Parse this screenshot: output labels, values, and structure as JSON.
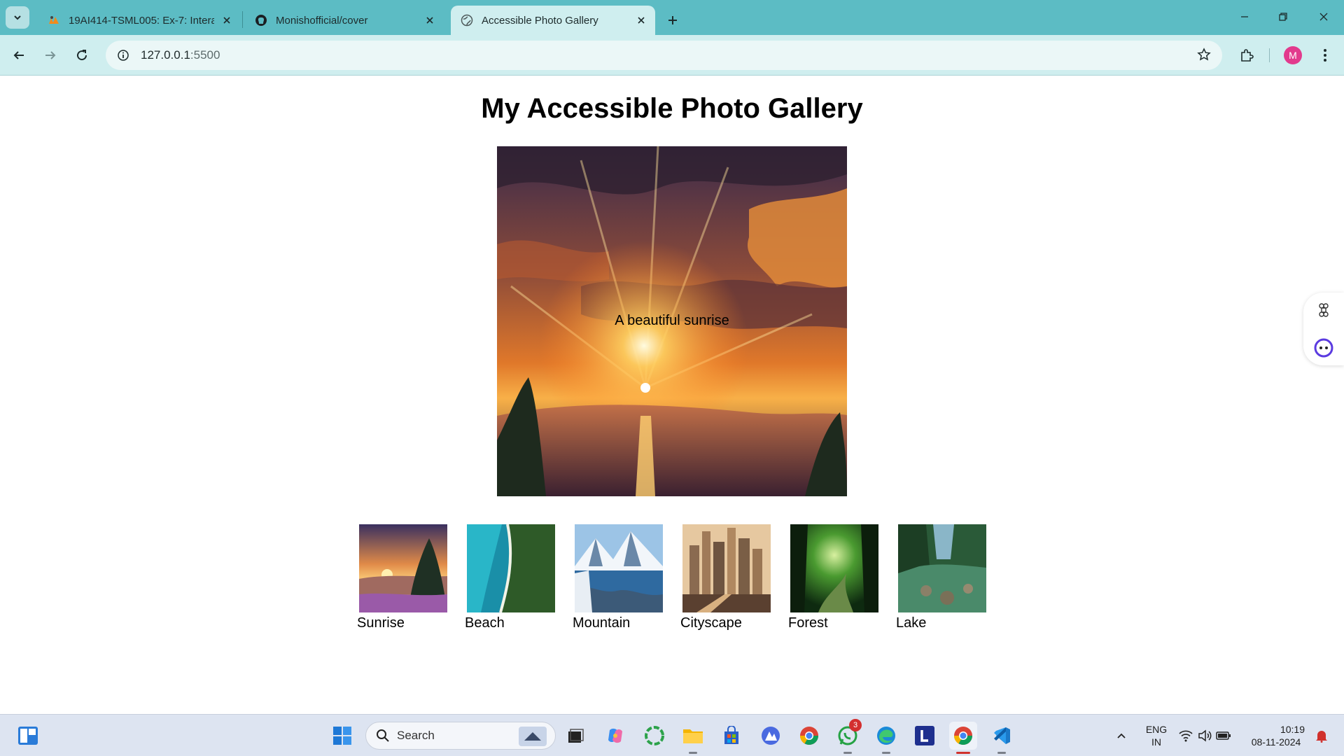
{
  "browser": {
    "tabs": [
      {
        "title": "19AI414-TSML005: Ex-7: Interac",
        "favicon": "moodle-icon",
        "active": false
      },
      {
        "title": "Monishofficial/cover",
        "favicon": "github-icon",
        "active": false
      },
      {
        "title": "Accessible Photo Gallery",
        "favicon": "globe-icon",
        "active": true
      }
    ],
    "url_host": "127.0.0.1",
    "url_port": ":5500",
    "profile_initial": "M",
    "accent_color": "#5cbcc4"
  },
  "page": {
    "title": "My Accessible Photo Gallery",
    "main_image": {
      "caption": "A beautiful sunrise",
      "alt": "A beautiful sunrise"
    },
    "thumbnails": [
      {
        "label": "Sunrise"
      },
      {
        "label": "Beach"
      },
      {
        "label": "Mountain"
      },
      {
        "label": "Cityscape"
      },
      {
        "label": "Forest"
      },
      {
        "label": "Lake"
      }
    ]
  },
  "taskbar": {
    "search_placeholder": "Search",
    "whatsapp_badge": "3",
    "language_line1": "ENG",
    "language_line2": "IN",
    "time": "10:19",
    "date": "08-11-2024"
  }
}
